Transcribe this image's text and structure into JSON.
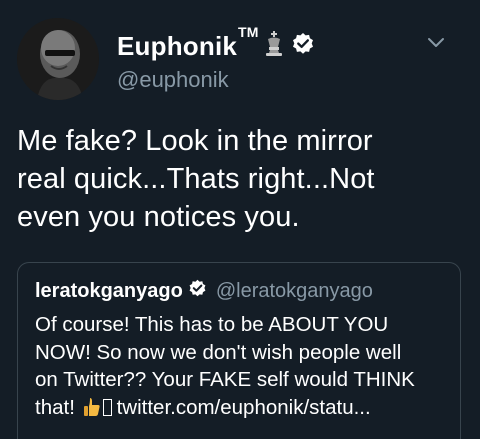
{
  "author": {
    "display_name": "Euphonik",
    "trademark": "TM",
    "handle": "@euphonik",
    "verified": true,
    "badge_icon": "chess-king-icon",
    "avatar": "profile-photo-bald-man-dark-background"
  },
  "tweet": {
    "text_lines": [
      "Me fake? Look in the mirror",
      "real quick...Thats right...Not",
      "even you notices you."
    ]
  },
  "quoted_tweet": {
    "display_name": "leratokganyago",
    "handle": "@leratokganyago",
    "verified": true,
    "text_lines": [
      "Of course! This has to be ABOUT YOU",
      "NOW! So now we don't wish people well",
      "on Twitter?? Your FAKE self would THINK"
    ],
    "last_line_start": "that!",
    "last_line_link": "twitter.com/euphonik/statu..."
  },
  "icons": {
    "menu": "chevron-down-icon",
    "verified": "verified-badge-icon",
    "emoji": "thumbs-up-icon"
  },
  "colors": {
    "background": "#141d26",
    "text": "#ffffff",
    "secondary_text": "#8899a6",
    "border": "#38444d",
    "verified_badge": "#ffffff"
  }
}
